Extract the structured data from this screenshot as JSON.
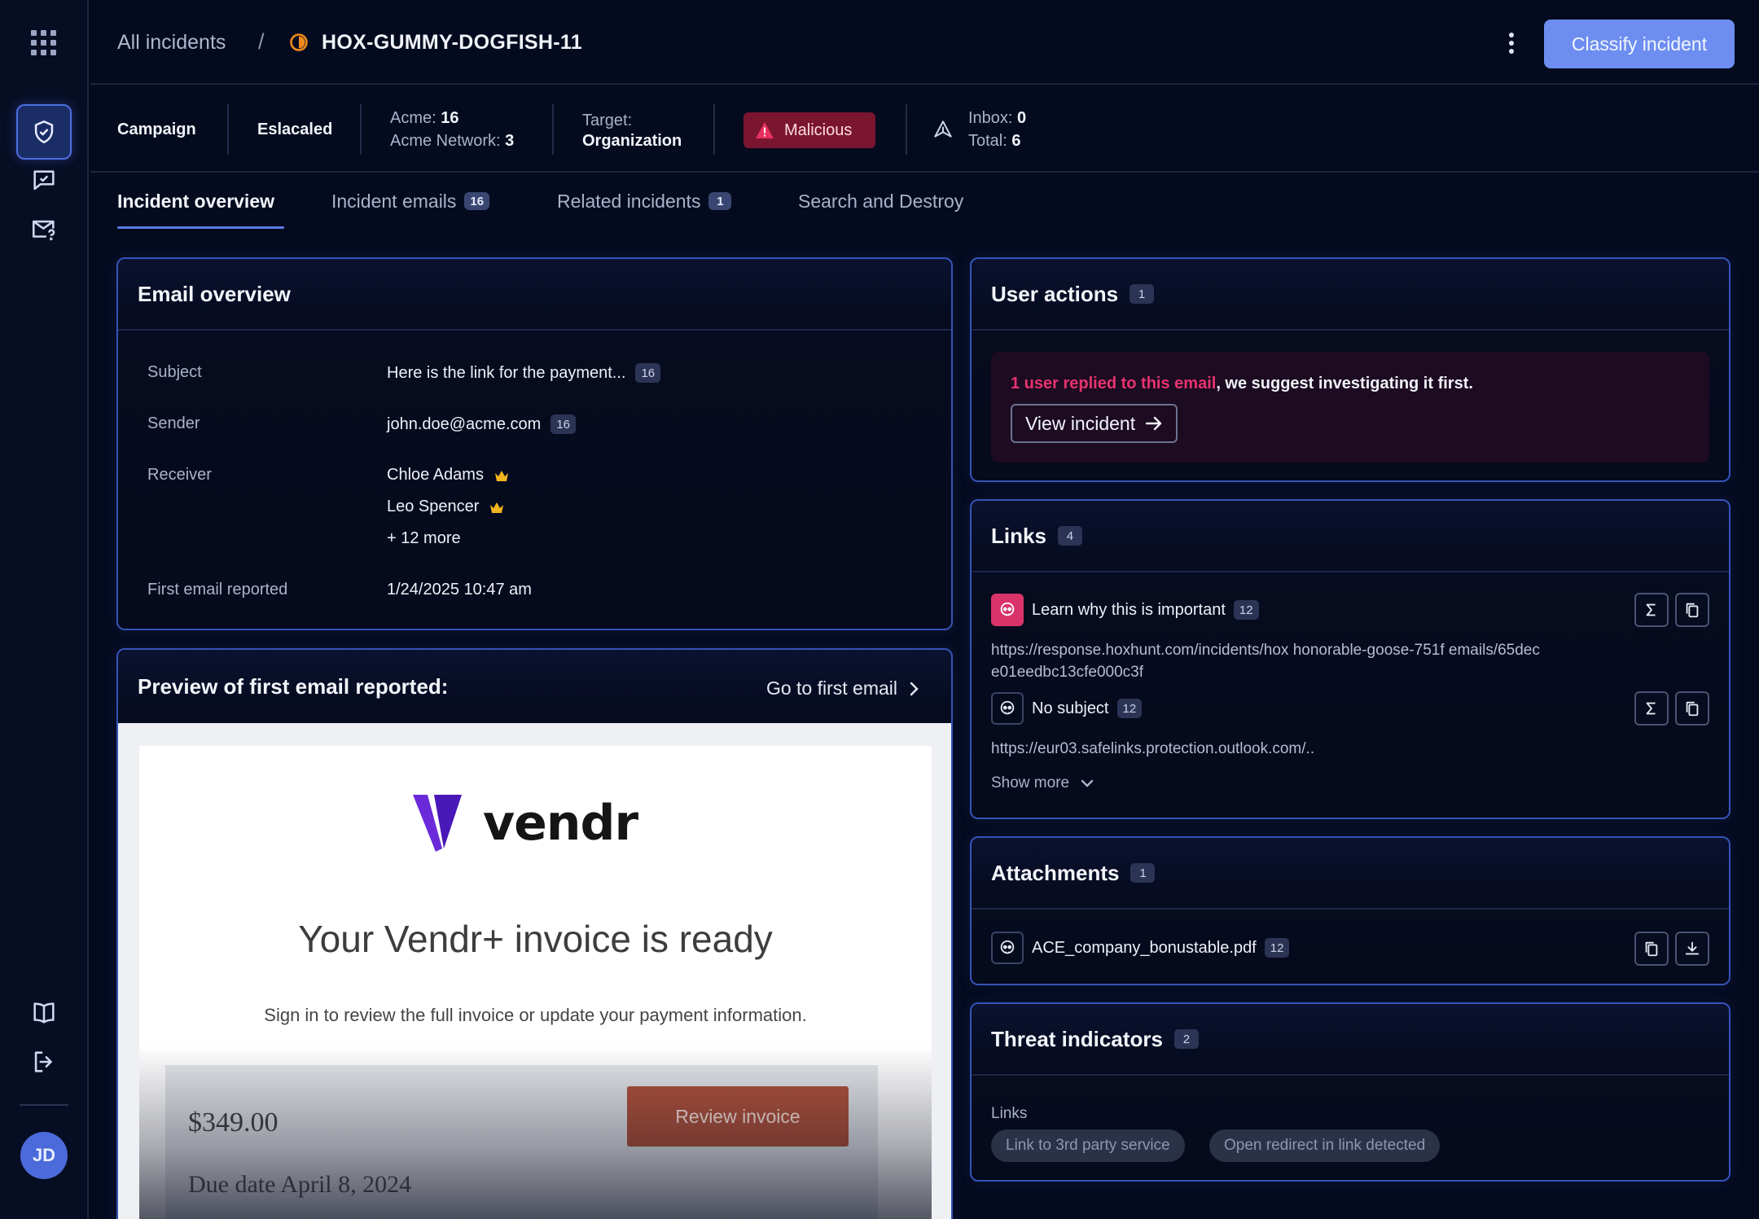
{
  "header": {
    "breadcrumb_root": "All incidents",
    "breadcrumb_sep": "/",
    "incident_id": "HOX-GUMMY-DOGFISH-11",
    "classify_label": "Classify incident"
  },
  "meta": {
    "campaign": "Campaign",
    "escalated": "Eslacaled",
    "acme_label": "Acme:",
    "acme_count": "16",
    "acme_network_label": "Acme Network:",
    "acme_network_count": "3",
    "target_label": "Target:",
    "target_value": "Organization",
    "malicious": "Malicious",
    "inbox_label": "Inbox:",
    "inbox_count": "0",
    "total_label": "Total:",
    "total_count": "6"
  },
  "tabs": [
    {
      "label": "Incident overview",
      "badge": ""
    },
    {
      "label": "Incident emails",
      "badge": "16"
    },
    {
      "label": "Related incidents",
      "badge": "1"
    },
    {
      "label": "Search and Destroy",
      "badge": ""
    }
  ],
  "email_overview": {
    "title": "Email overview",
    "subject_label": "Subject",
    "subject_value": "Here is the link for the payment...",
    "subject_badge": "16",
    "sender_label": "Sender",
    "sender_value": "john.doe@acme.com",
    "sender_badge": "16",
    "receiver_label": "Receiver",
    "receivers": [
      "Chloe Adams",
      "Leo Spencer"
    ],
    "receivers_more": "+ 12 more",
    "first_reported_label": "First email reported",
    "first_reported_value": "1/24/2025 10:47 am"
  },
  "preview": {
    "title": "Preview of first email reported:",
    "go_link": "Go to first email",
    "brand": "vendr",
    "headline": "Your Vendr+ invoice is ready",
    "subline": "Sign in to review the full invoice or update your payment information.",
    "amount": "$349.00",
    "due": "Due date April 8, 2024",
    "cta": "Review invoice"
  },
  "user_actions": {
    "title": "User actions",
    "badge": "1",
    "alert_highlight": "1 user replied to this email",
    "alert_rest": ", we suggest investigating it first.",
    "button": "View incident"
  },
  "links": {
    "title": "Links",
    "badge": "4",
    "items": [
      {
        "label": "Learn why this is important",
        "badge": "12",
        "url": "https://response.hoxhunt.com/incidents/hox honorable-goose-751f emails/65dece01eedbc13cfe000c3f"
      },
      {
        "label": "No subject",
        "badge": "12",
        "url": "https://eur03.safelinks.protection.outlook.com/.."
      }
    ],
    "show_more": "Show more"
  },
  "attachments": {
    "title": "Attachments",
    "badge": "1",
    "file": "ACE_company_bonustable.pdf",
    "file_badge": "12"
  },
  "threats": {
    "title": "Threat indicators",
    "badge": "2",
    "section": "Links",
    "chips": [
      "Link to 3rd party service",
      "Open redirect in link detected"
    ]
  },
  "user": {
    "initials": "JD"
  },
  "colors": {
    "accent": "#6d8ef0",
    "danger": "#e7336f",
    "panel_border": "#3553b8",
    "background": "#050b1f"
  }
}
